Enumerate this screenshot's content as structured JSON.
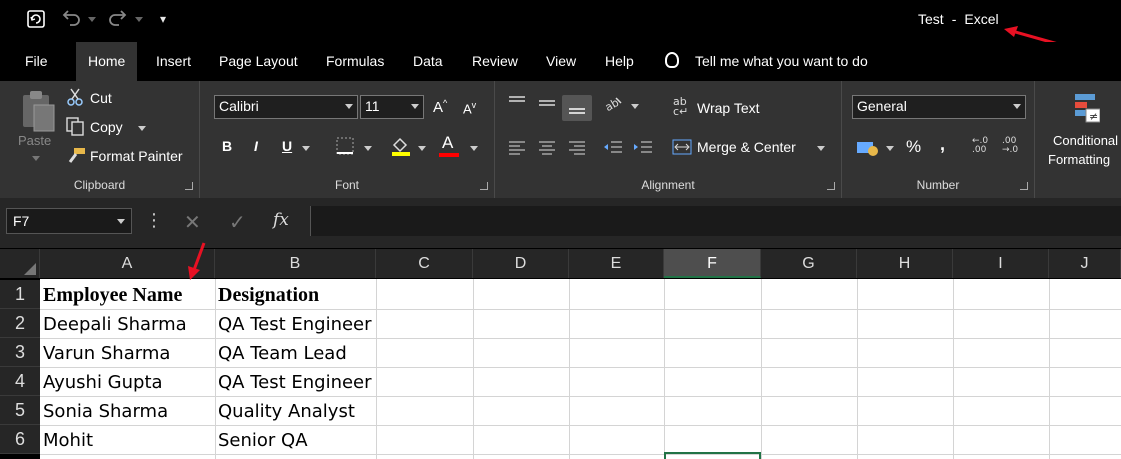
{
  "window": {
    "doc_name": "Test",
    "separator": "-",
    "app_name": "Excel"
  },
  "quick_access": {
    "save": "save-icon",
    "undo": "undo-icon",
    "redo": "redo-icon",
    "customize": "customize-icon"
  },
  "menu": {
    "tabs": [
      "File",
      "Home",
      "Insert",
      "Page Layout",
      "Formulas",
      "Data",
      "Review",
      "View",
      "Help"
    ],
    "active": "Home",
    "tell_me": "Tell me what you want to do"
  },
  "ribbon": {
    "clipboard": {
      "paste": "Paste",
      "cut": "Cut",
      "copy": "Copy",
      "format_painter": "Format Painter",
      "label": "Clipboard"
    },
    "font": {
      "family": "Calibri",
      "size": "11",
      "bold": "B",
      "italic": "I",
      "underline": "U",
      "font_color_letter": "A",
      "grow": "A",
      "shrink": "A",
      "label": "Font"
    },
    "alignment": {
      "wrap_text": "Wrap Text",
      "merge_center": "Merge & Center",
      "label": "Alignment"
    },
    "number": {
      "format": "General",
      "percent": "%",
      "comma": ",",
      "label": "Number"
    },
    "styles": {
      "conditional_line1": "Conditional",
      "conditional_line2": "Formatting"
    }
  },
  "formula_bar": {
    "name_box": "F7",
    "fx": "fx",
    "cancel": "✕",
    "enter": "✓",
    "more": "⋮"
  },
  "grid": {
    "columns": [
      "A",
      "B",
      "C",
      "D",
      "E",
      "F",
      "G",
      "H",
      "I",
      "J"
    ],
    "selected_column": "F",
    "rows": [
      "1",
      "2",
      "3",
      "4",
      "5",
      "6"
    ],
    "cells": [
      [
        "Employee Name",
        "Designation"
      ],
      [
        "Deepali Sharma",
        "QA Test Engineer"
      ],
      [
        "Varun Sharma",
        "QA Team Lead"
      ],
      [
        "Ayushi Gupta",
        "QA Test Engineer"
      ],
      [
        "Sonia Sharma",
        "Quality Analyst"
      ],
      [
        "Mohit",
        "Senior QA"
      ]
    ]
  },
  "colors": {
    "accent": "#217346",
    "annotation": "#e81123",
    "font_color_bar": "#ff0000",
    "fill_color_bar": "#ffff00"
  }
}
